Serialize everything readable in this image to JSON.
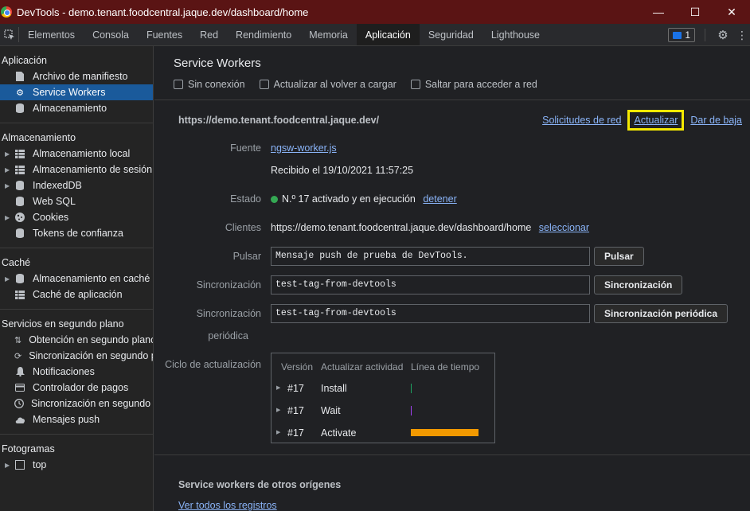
{
  "window": {
    "title": "DevTools - demo.tenant.foodcentral.jaque.dev/dashboard/home",
    "icon": "chrome-icon"
  },
  "tabs": [
    "Elementos",
    "Consola",
    "Fuentes",
    "Red",
    "Rendimiento",
    "Memoria",
    "Aplicación",
    "Seguridad",
    "Lighthouse"
  ],
  "active_tab": "Aplicación",
  "issues_count": "1",
  "sidebar": {
    "app_title": "Aplicación",
    "app_items": [
      "Archivo de manifiesto",
      "Service Workers",
      "Almacenamiento"
    ],
    "storage_title": "Almacenamiento",
    "storage_items": [
      "Almacenamiento local",
      "Almacenamiento de sesión",
      "IndexedDB",
      "Web SQL",
      "Cookies",
      "Tokens de confianza"
    ],
    "cache_title": "Caché",
    "cache_items": [
      "Almacenamiento en caché",
      "Caché de aplicación"
    ],
    "bg_title": "Servicios en segundo plano",
    "bg_items": [
      "Obtención en segundo plano",
      "Sincronización en segundo plano",
      "Notificaciones",
      "Controlador de pagos",
      "Sincronización en segundo plano periódica",
      "Mensajes push"
    ],
    "frames_title": "Fotogramas",
    "frames_items": [
      "top"
    ]
  },
  "main": {
    "title": "Service Workers",
    "options": [
      "Sin conexión",
      "Actualizar al volver a cargar",
      "Saltar para acceder a red"
    ],
    "origin": "https://demo.tenant.foodcentral.jaque.dev/",
    "links": {
      "network": "Solicitudes de red",
      "update": "Actualizar",
      "unregister": "Dar de baja"
    },
    "source_label": "Fuente",
    "source_file": "ngsw-worker.js",
    "received": "Recibido el 19/10/2021 11:57:25",
    "status_label": "Estado",
    "status_text": "N.º 17 activado y en ejecución",
    "stop_link": "detener",
    "clients_label": "Clientes",
    "clients_url": "https://demo.tenant.foodcentral.jaque.dev/dashboard/home",
    "select_link": "seleccionar",
    "push_label": "Pulsar",
    "push_value": "Mensaje push de prueba de DevTools.",
    "push_button": "Pulsar",
    "sync_label": "Sincronización",
    "sync_value": "test-tag-from-devtools",
    "sync_button": "Sincronización",
    "periodic_label_1": "Sincronización",
    "periodic_label_2": "periódica",
    "periodic_value": "test-tag-from-devtools",
    "periodic_button": "Sincronización periódica",
    "cycle_label": "Ciclo de actualización",
    "cycle_headers": [
      "Versión",
      "Actualizar actividad",
      "Línea de tiempo"
    ],
    "cycle_rows": [
      {
        "version": "#17",
        "activity": "Install",
        "color": "#1ea362"
      },
      {
        "version": "#17",
        "activity": "Wait",
        "color": "#a142f4"
      },
      {
        "version": "#17",
        "activity": "Activate",
        "color": "#f29900"
      }
    ],
    "others_title": "Service workers de otros orígenes",
    "others_link": "Ver todos los registros"
  }
}
